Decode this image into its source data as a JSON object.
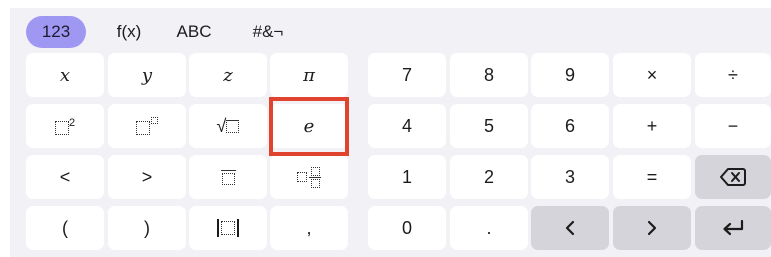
{
  "tabs": [
    {
      "label": "123",
      "active": true
    },
    {
      "label": "f(x)",
      "active": false
    },
    {
      "label": "ABC",
      "active": false
    },
    {
      "label": "#&¬",
      "active": false
    }
  ],
  "keys": {
    "x": "x",
    "y": "y",
    "z": "z",
    "pi": "π",
    "e": "e",
    "lt": "<",
    "gt": ">",
    "lparen": "(",
    "rparen": ")",
    "comma": ",",
    "n7": "7",
    "n8": "8",
    "n9": "9",
    "times": "×",
    "divide": "÷",
    "n4": "4",
    "n5": "5",
    "n6": "6",
    "plus": "+",
    "minus": "−",
    "n1": "1",
    "n2": "2",
    "n3": "3",
    "equals": "=",
    "n0": "0",
    "dot": ".",
    "left": "‹",
    "right": "›",
    "superscript_2": "2",
    "sqrt": "√"
  },
  "colors": {
    "active_tab": "#9f98f2",
    "highlight": "#e0442f",
    "gray_key": "#d4d4da",
    "panel": "#f2f2f6"
  },
  "icons": {
    "square": "square-icon",
    "power": "power-icon",
    "sqrt": "sqrt-icon",
    "overline": "overline-icon",
    "subscript": "subscript-icon",
    "abs": "absolute-value-icon",
    "backspace": "backspace-icon",
    "enter": "enter-icon"
  }
}
